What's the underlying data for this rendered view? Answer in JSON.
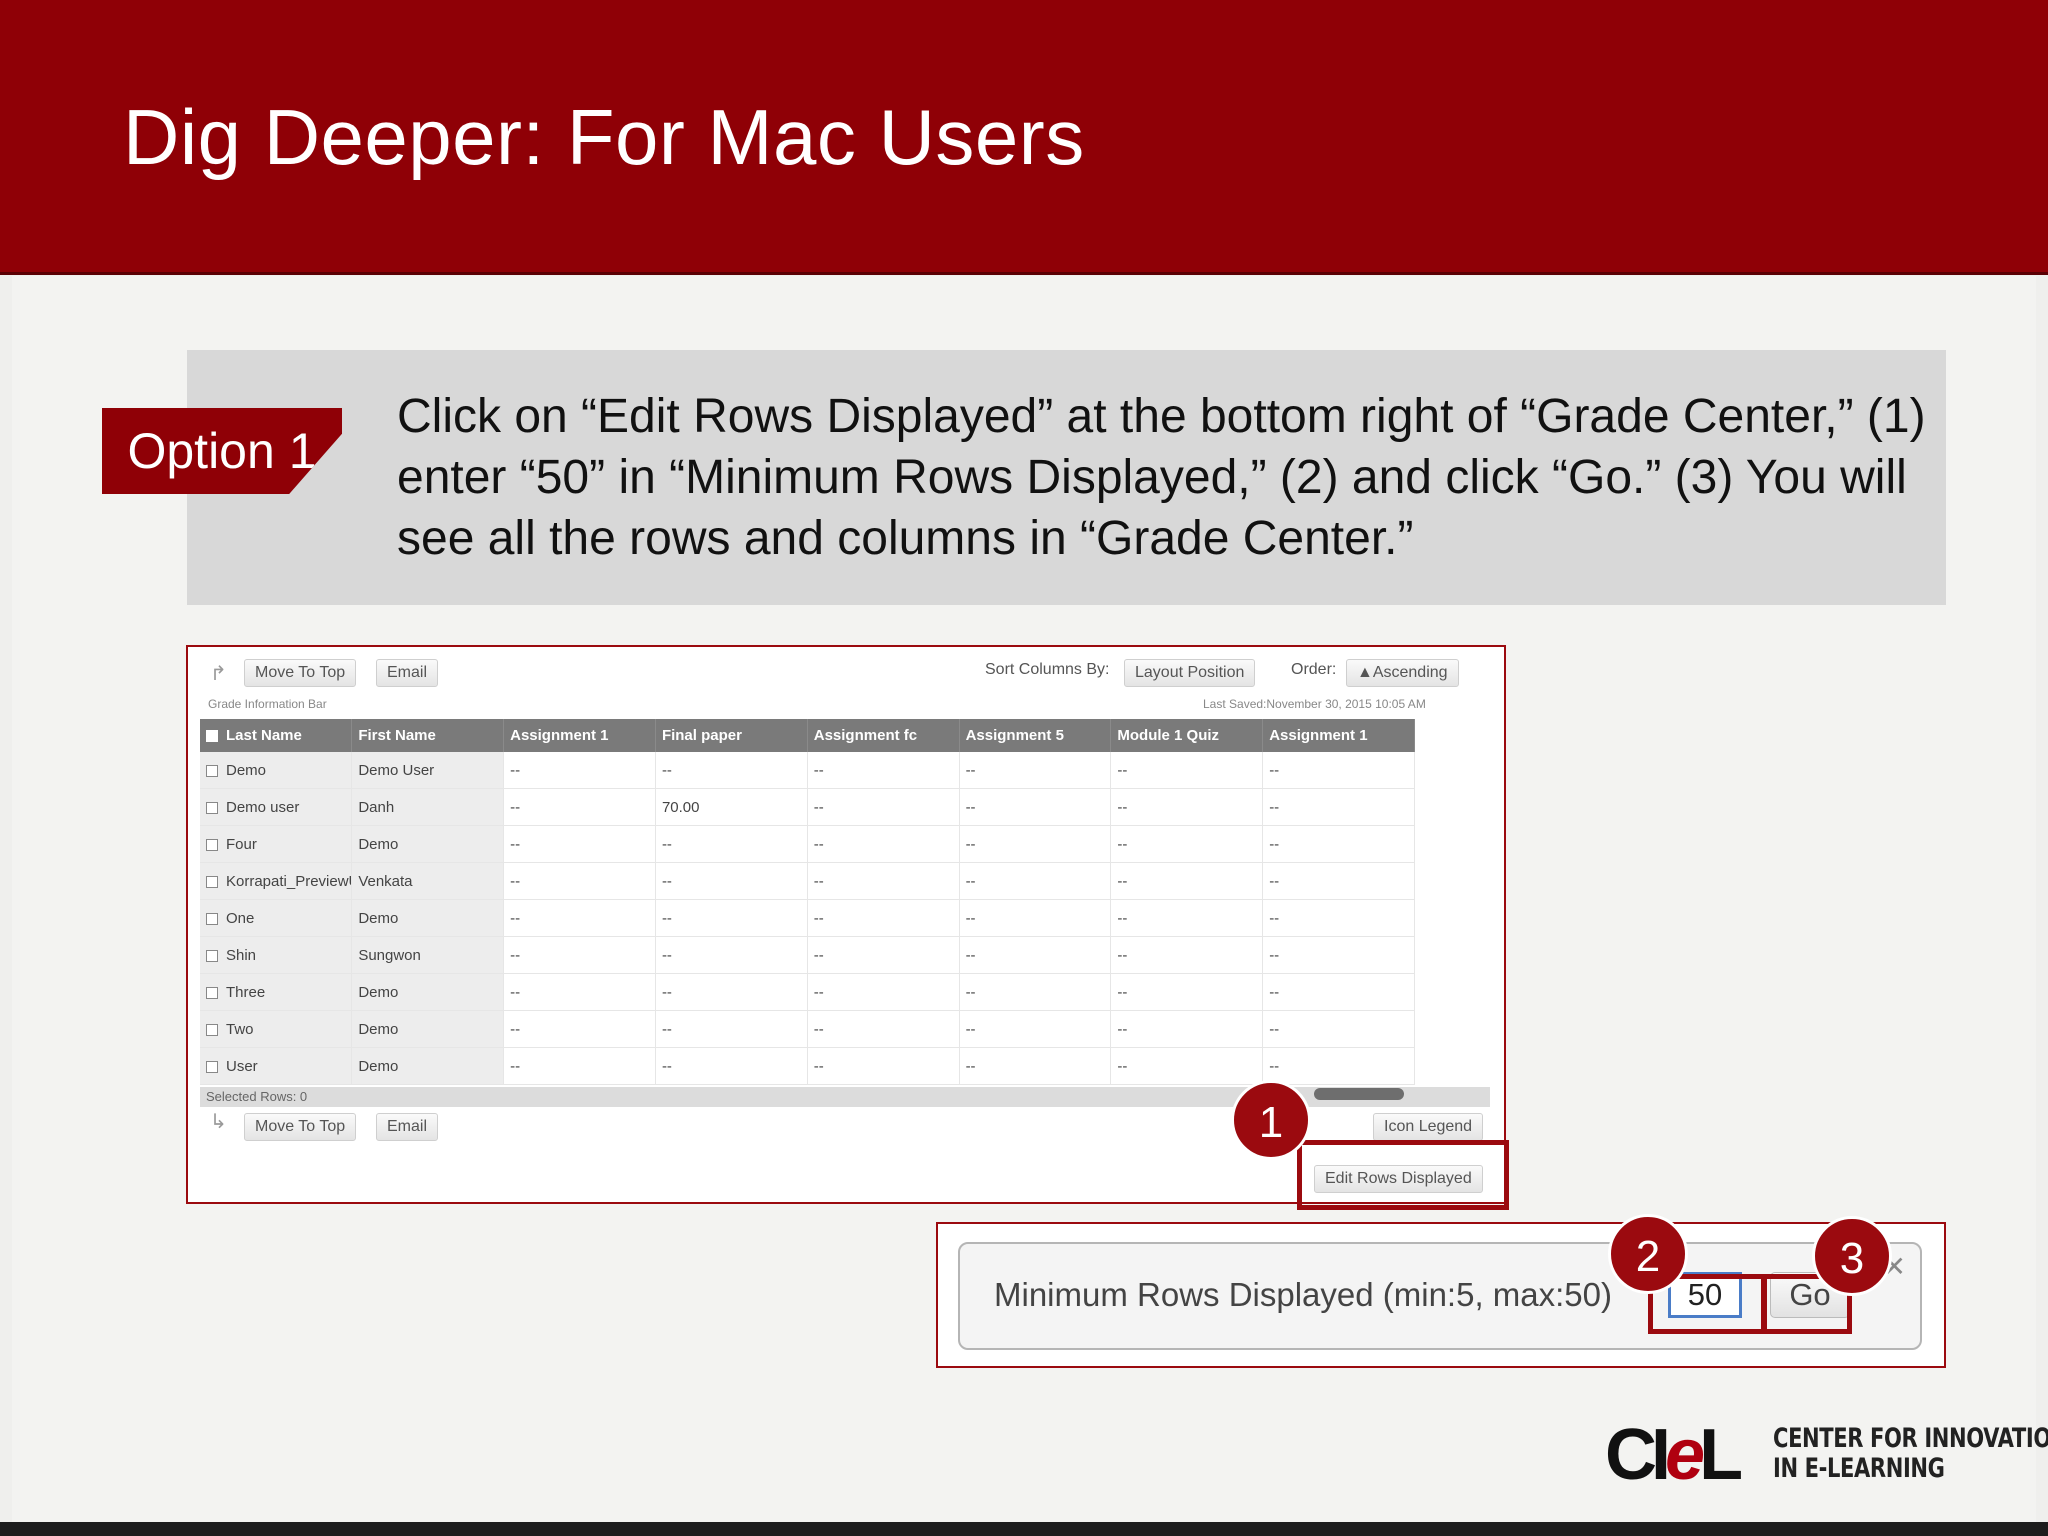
{
  "slide": {
    "title": "Dig Deeper: For Mac Users",
    "option_label": "Option 1",
    "instruction": "Click on “Edit Rows Displayed” at the bottom right of “Grade Center,” (1) enter “50” in “Minimum Rows Displayed,” (2) and click “Go.” (3) You will see all the rows and columns in “Grade Center.”"
  },
  "grade_center": {
    "move_to_top": "Move To Top",
    "email": "Email",
    "sort_label": "Sort Columns By:",
    "sort_value": "Layout Position",
    "order_label": "Order:",
    "order_value": "▲Ascending",
    "info_bar": "Grade Information Bar",
    "last_saved": "Last Saved:November 30, 2015 10:05 AM",
    "columns": [
      "Last Name",
      "First Name",
      "Assignment 1",
      "Final paper",
      "Assignment fc",
      "Assignment 5",
      "Module 1 Quiz",
      "Assignment 1"
    ],
    "rows": [
      {
        "last": "Demo",
        "first": "Demo User",
        "cells": [
          "--",
          "--",
          "--",
          "--",
          "--",
          "--"
        ]
      },
      {
        "last": "Demo user",
        "first": "Danh",
        "cells": [
          "--",
          "70.00",
          "--",
          "--",
          "--",
          "--"
        ]
      },
      {
        "last": "Four",
        "first": "Demo",
        "cells": [
          "--",
          "--",
          "--",
          "--",
          "--",
          "--"
        ]
      },
      {
        "last": "Korrapati_PreviewU",
        "first": "Venkata",
        "cells": [
          "--",
          "--",
          "--",
          "--",
          "--",
          "--"
        ]
      },
      {
        "last": "One",
        "first": "Demo",
        "cells": [
          "--",
          "--",
          "--",
          "--",
          "--",
          "--"
        ]
      },
      {
        "last": "Shin",
        "first": "Sungwon",
        "cells": [
          "--",
          "--",
          "--",
          "--",
          "--",
          "--"
        ]
      },
      {
        "last": "Three",
        "first": "Demo",
        "cells": [
          "--",
          "--",
          "--",
          "--",
          "--",
          "--"
        ]
      },
      {
        "last": "Two",
        "first": "Demo",
        "cells": [
          "--",
          "--",
          "--",
          "--",
          "--",
          "--"
        ]
      },
      {
        "last": "User",
        "first": "Demo",
        "cells": [
          "--",
          "--",
          "--",
          "--",
          "--",
          "--"
        ]
      }
    ],
    "selected_rows": "Selected Rows: 0",
    "icon_legend": "Icon Legend",
    "edit_rows": "Edit Rows Displayed"
  },
  "dialog": {
    "label": "Minimum Rows Displayed (min:5, max:50)",
    "input_value": "50",
    "go": "Go",
    "close": "✕"
  },
  "steps": [
    "1",
    "2",
    "3"
  ],
  "logo": {
    "mark_c": "C",
    "mark_i": "I",
    "mark_e": "e",
    "mark_l": "L",
    "line1": "CENTER FOR INNOVATION",
    "line2": "IN E-LEARNING"
  },
  "colors": {
    "brand": "#8f0006",
    "callout_bg": "#d8d8d8",
    "highlight": "#9b0a0f"
  }
}
